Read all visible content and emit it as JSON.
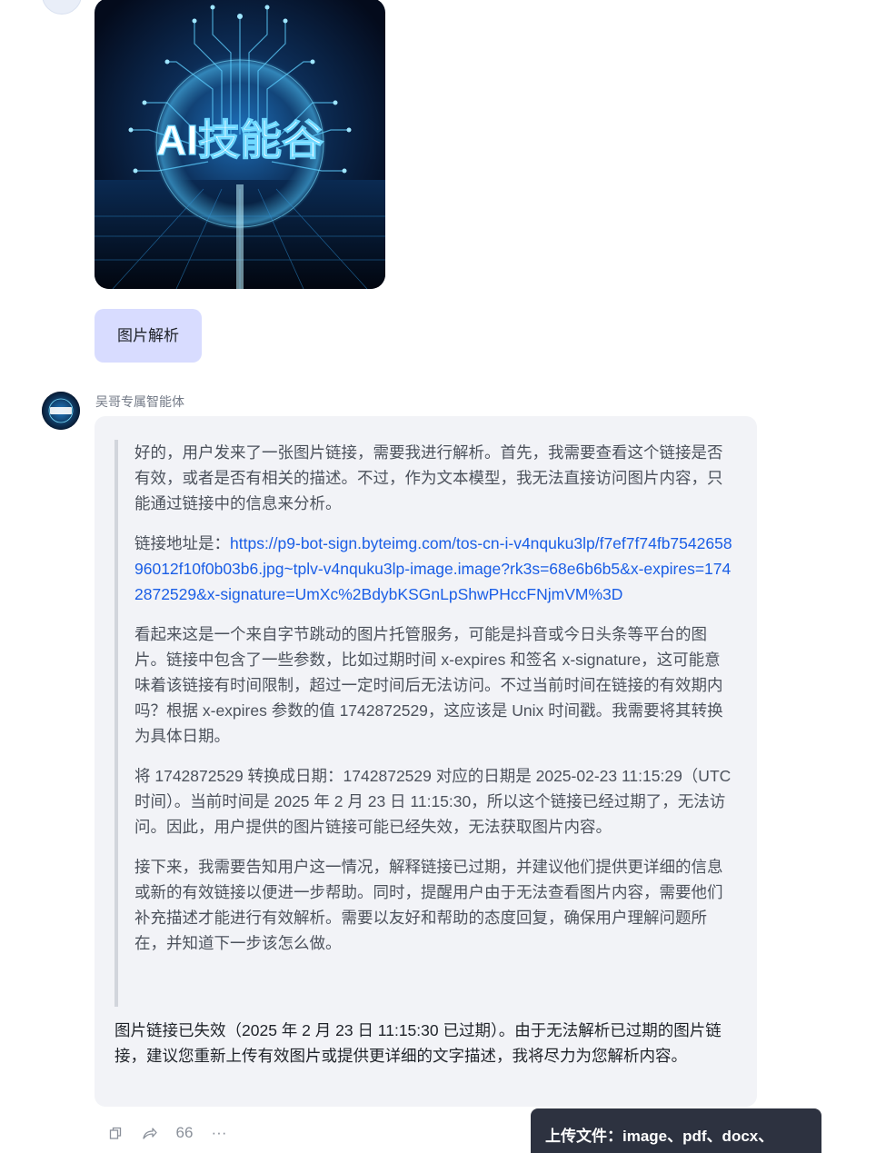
{
  "conversation": {
    "uploaded_image": {
      "label_text": "AI技能谷"
    },
    "user_message": "图片解析",
    "bot": {
      "name": "吴哥专属智能体",
      "reasoning": {
        "p1": "好的，用户发来了一张图片链接，需要我进行解析。首先，我需要查看这个链接是否有效，或者是否有相关的描述。不过，作为文本模型，我无法直接访问图片内容，只能通过链接中的信息来分析。",
        "p2_prefix": "链接地址是：",
        "p2_link": "https://p9-bot-sign.byteimg.com/tos-cn-i-v4nquku3lp/f7ef7f74fb754265896012f10f0b03b6.jpg~tplv-v4nquku3lp-image.image?rk3s=68e6b6b5&x-expires=1742872529&x-signature=UmXc%2BdybKSGnLpShwPHccFNjmVM%3D",
        "p3": "看起来这是一个来自字节跳动的图片托管服务，可能是抖音或今日头条等平台的图片。链接中包含了一些参数，比如过期时间 x-expires 和签名 x-signature，这可能意味着该链接有时间限制，超过一定时间后无法访问。不过当前时间在链接的有效期内吗？根据 x-expires 参数的值 1742872529，这应该是 Unix 时间戳。我需要将其转换为具体日期。",
        "p4": "将 1742872529 转换成日期：1742872529 对应的日期是 2025-02-23 11:15:29（UTC 时间）。当前时间是 2025 年 2 月 23 日 11:15:30，所以这个链接已经过期了，无法访问。因此，用户提供的图片链接可能已经失效，无法获取图片内容。",
        "p5": "接下来，我需要告知用户这一情况，解释链接已过期，并建议他们提供更详细的信息或新的有效链接以便进一步帮助。同时，提醒用户由于无法查看图片内容，需要他们补充描述才能进行有效解析。需要以友好和帮助的态度回复，确保用户理解问题所在，并知道下一步该怎么做。"
      },
      "answer": "图片链接已失效（2025 年 2 月 23 日 11:15:30 已过期）。由于无法解析已过期的图片链接，建议您重新上传有效图片或提供更详细的文字描述，我将尽力为您解析内容。"
    },
    "actions": [
      {
        "icon": "copy-icon"
      },
      {
        "icon": "share-icon"
      },
      {
        "icon": "quote-icon",
        "glyph": "66"
      },
      {
        "icon": "more-icon",
        "glyph": "···"
      }
    ]
  },
  "tooltip": {
    "text": "上传文件：image、pdf、docx、"
  },
  "colors": {
    "user_bubble": "#d8dcff",
    "card_bg": "#f2f3f7",
    "link": "#1a5ee6",
    "tooltip_bg": "#2d3240"
  }
}
